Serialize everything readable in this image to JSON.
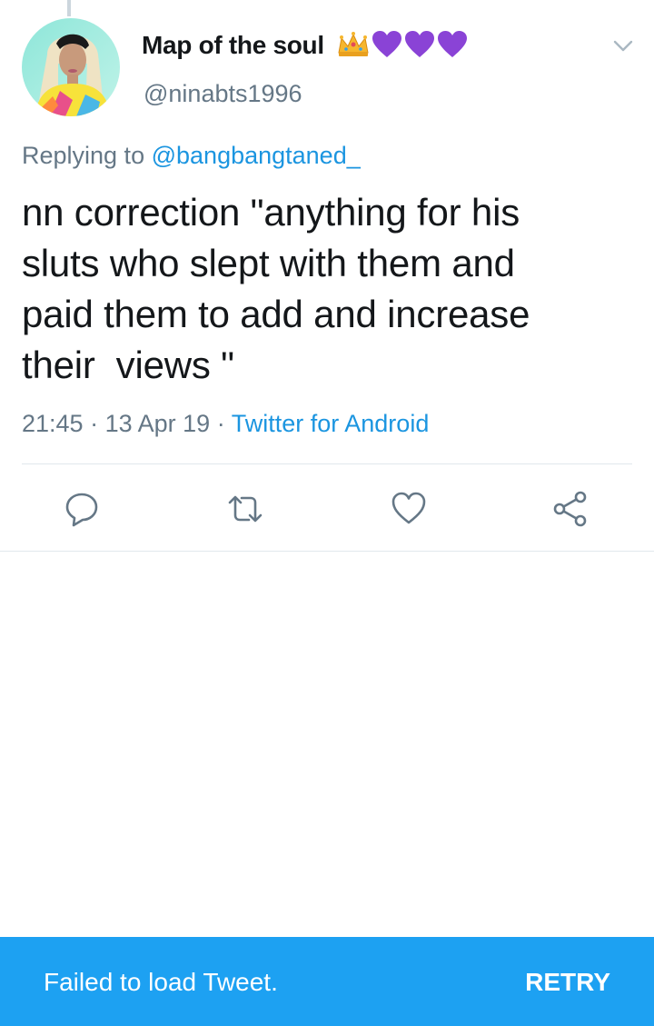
{
  "tweet": {
    "display_name": "Map of the soul",
    "name_emojis": [
      "crown-emoji",
      "purple-heart-emoji",
      "purple-heart-emoji",
      "purple-heart-emoji"
    ],
    "handle": "@ninabts1996",
    "reply_prefix": "Replying to",
    "reply_to": "@bangbangtaned_",
    "text": "nn correction \"anything for his\nsluts who slept with them and\npaid them to add and increase\ntheir  views \"",
    "time": "21:45",
    "date": "13 Apr 19",
    "separator": "·",
    "source": "Twitter for Android"
  },
  "actions": [
    {
      "name": "reply",
      "icon": "reply-icon"
    },
    {
      "name": "retweet",
      "icon": "retweet-icon"
    },
    {
      "name": "like",
      "icon": "heart-icon"
    },
    {
      "name": "share",
      "icon": "share-icon"
    }
  ],
  "snackbar": {
    "message": "Failed to load Tweet.",
    "action_label": "RETRY"
  },
  "colors": {
    "accent": "#1da1f2",
    "link": "#1b95e0",
    "secondary_text": "#657786",
    "emoji_purple": "#8a43d6"
  }
}
